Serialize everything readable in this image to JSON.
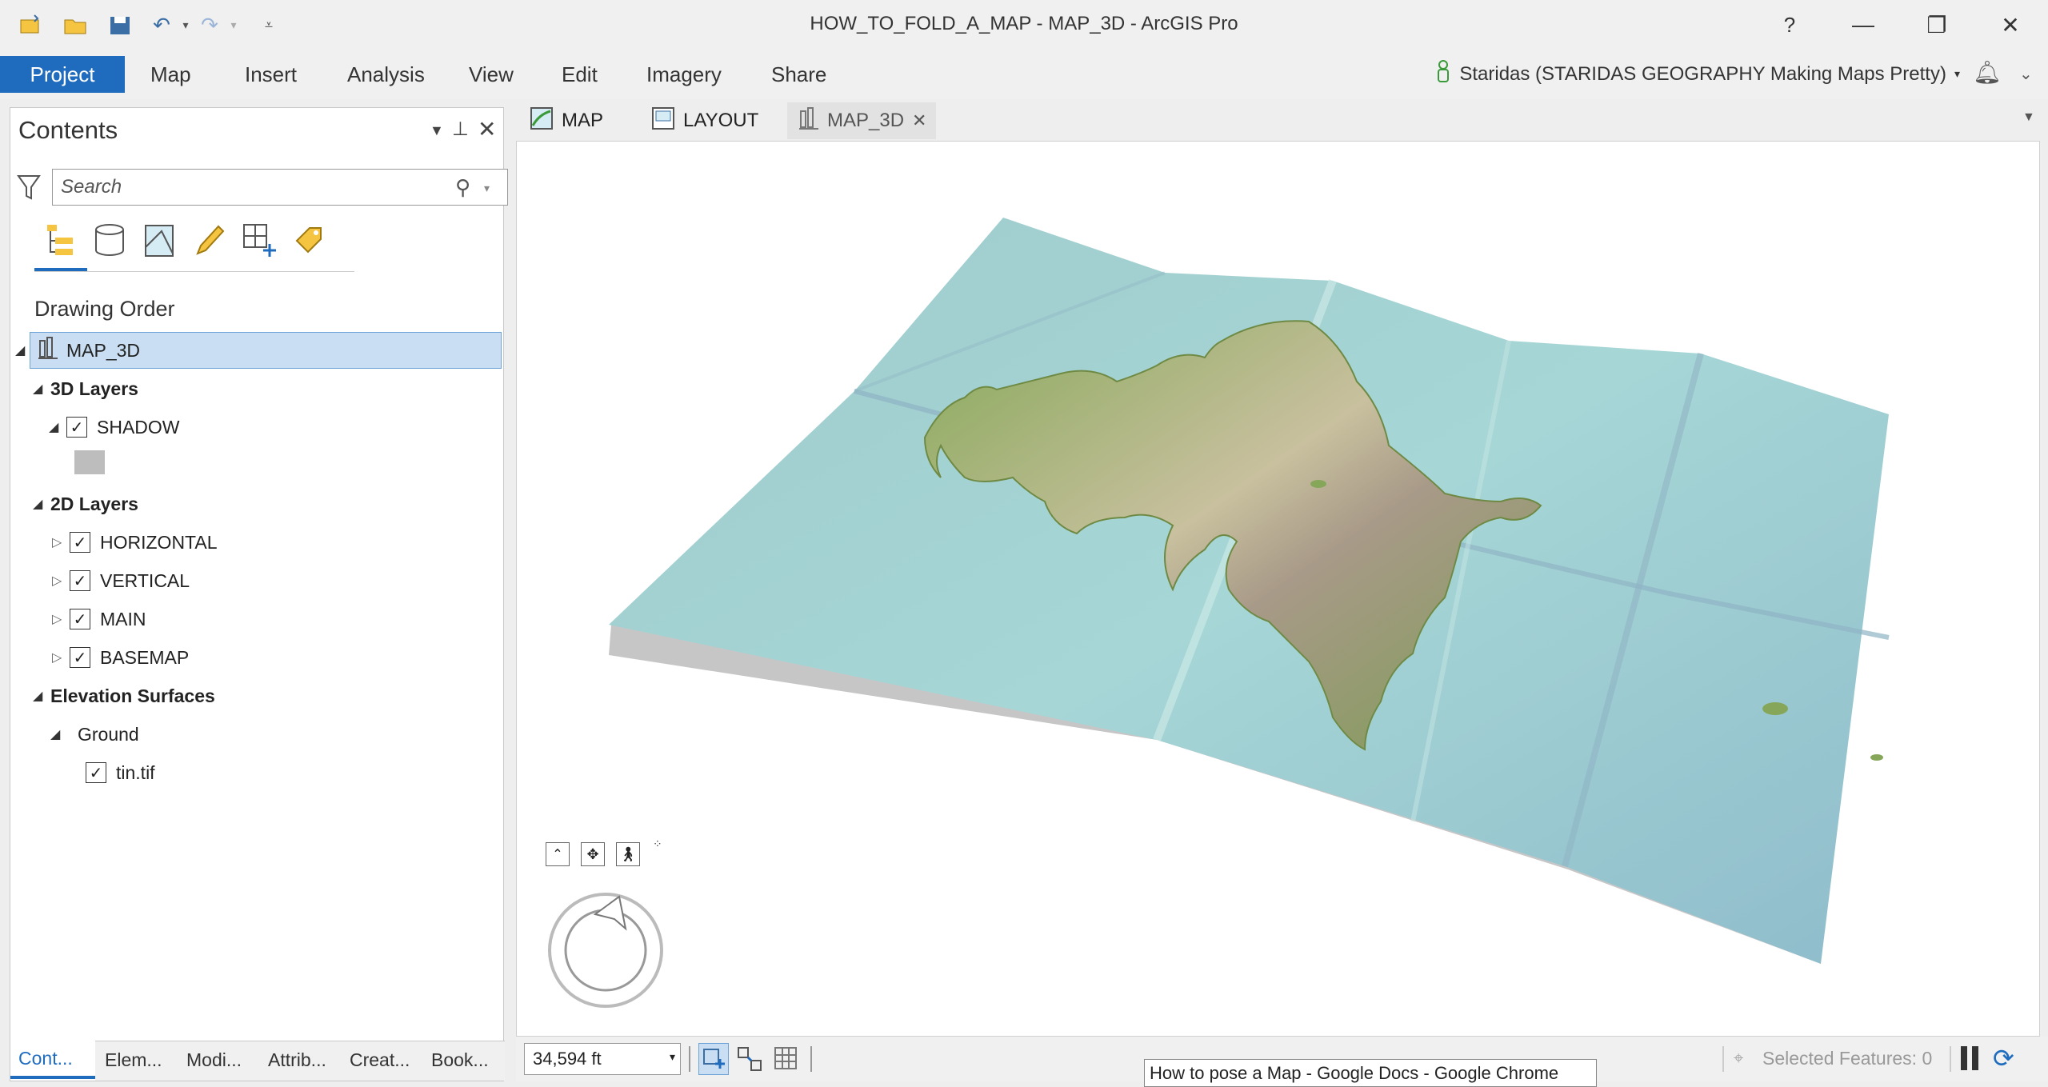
{
  "window": {
    "title": "HOW_TO_FOLD_A_MAP - MAP_3D - ArcGIS Pro",
    "help": "?",
    "minimize": "—",
    "restore": "❐",
    "close": "✕"
  },
  "ribbon": {
    "tabs": [
      "Project",
      "Map",
      "Insert",
      "Analysis",
      "View",
      "Edit",
      "Imagery",
      "Share"
    ],
    "active_tab": "Project",
    "user": "Staridas (STARIDAS GEOGRAPHY Making Maps Pretty)",
    "accent": "#1f6cbf"
  },
  "contents": {
    "title": "Contents",
    "search_placeholder": "Search",
    "heading": "Drawing Order",
    "root": "MAP_3D",
    "groups": {
      "layers3d": "3D Layers",
      "shadow": "SHADOW",
      "layers2d": "2D Layers",
      "horizontal": "HORIZONTAL",
      "vertical": "VERTICAL",
      "main": "MAIN",
      "basemap": "BASEMAP",
      "elevation": "Elevation Surfaces",
      "ground": "Ground",
      "tin": "tin.tif"
    },
    "bottom_tabs": [
      "Cont...",
      "Elem...",
      "Modi...",
      "Attrib...",
      "Creat...",
      "Book..."
    ]
  },
  "doc_tabs": {
    "map": "MAP",
    "layout": "LAYOUT",
    "map3d": "MAP_3D"
  },
  "status": {
    "scale": "34,594 ft",
    "selected": "Selected Features: 0"
  },
  "tooltip": "How to pose a Map - Google Docs - Google Chrome"
}
